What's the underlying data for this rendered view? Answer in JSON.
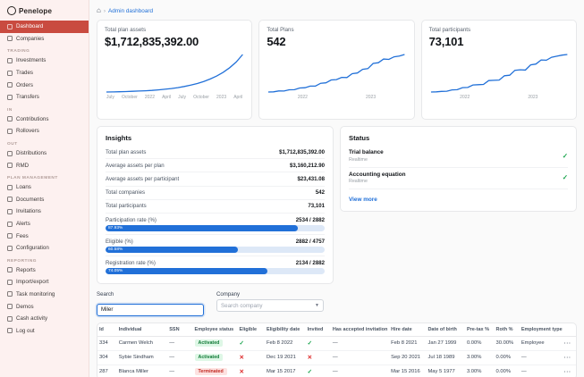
{
  "theme": {
    "accent_blue": "#2170d8",
    "sidebar_active_red": "#c94b40",
    "success_green": "#16a34a",
    "danger_red": "#dc2626",
    "chart_line": "#2170d8"
  },
  "sidebar": {
    "logo": "Penelope",
    "items": [
      {
        "label": "Dashboard",
        "icon": "dashboard-icon",
        "active": true
      },
      {
        "label": "Companies",
        "icon": "companies-icon"
      },
      {
        "section": "TRADING"
      },
      {
        "label": "Investments",
        "icon": "investments-icon"
      },
      {
        "label": "Trades",
        "icon": "trades-icon"
      },
      {
        "label": "Orders",
        "icon": "orders-icon"
      },
      {
        "label": "Transfers",
        "icon": "transfers-icon"
      },
      {
        "section": "IN"
      },
      {
        "label": "Contributions",
        "icon": "contributions-icon"
      },
      {
        "label": "Rollovers",
        "icon": "rollovers-icon"
      },
      {
        "section": "OUT"
      },
      {
        "label": "Distributions",
        "icon": "distributions-icon"
      },
      {
        "label": "RMD",
        "icon": "rmd-icon"
      },
      {
        "section": "PLAN MANAGEMENT"
      },
      {
        "label": "Loans",
        "icon": "loans-icon"
      },
      {
        "label": "Documents",
        "icon": "documents-icon"
      },
      {
        "label": "Invitations",
        "icon": "invitations-icon"
      },
      {
        "label": "Alerts",
        "icon": "alerts-icon"
      },
      {
        "label": "Fees",
        "icon": "fees-icon"
      },
      {
        "label": "Configuration",
        "icon": "configuration-icon"
      },
      {
        "section": "REPORTING"
      },
      {
        "label": "Reports",
        "icon": "reports-icon"
      },
      {
        "label": "Import/export",
        "icon": "import-export-icon"
      },
      {
        "label": "Task monitoring",
        "icon": "task-monitoring-icon"
      },
      {
        "label": "Demos",
        "icon": "demos-icon"
      },
      {
        "label": "Cash activity",
        "icon": "cash-activity-icon"
      },
      {
        "label": "Log out",
        "icon": "log-out-icon"
      }
    ]
  },
  "breadcrumb": {
    "current": "Admin dashboard"
  },
  "chart_data": [
    {
      "type": "line",
      "title": "Total plan assets",
      "value_label": "$1,712,835,392.00",
      "x_ticks": [
        "July",
        "October",
        "2022",
        "April",
        "July",
        "October",
        "2023",
        "April"
      ],
      "values": [
        1,
        1.05,
        1.1,
        1.18,
        1.27,
        1.38,
        1.5,
        1.66,
        1.85,
        2.1,
        2.4,
        2.75,
        3.2,
        3.75,
        4.4,
        5.2,
        6.2,
        7.4,
        8.9,
        10.7,
        13,
        16
      ]
    },
    {
      "type": "line",
      "title": "Total Plans",
      "value_label": "542",
      "x_ticks": [
        "2022",
        "2023"
      ],
      "values": [
        30,
        32,
        45,
        44,
        60,
        62,
        85,
        88,
        110,
        112,
        150,
        155,
        195,
        200,
        230,
        228,
        280,
        290,
        340,
        350,
        420,
        430,
        480,
        475,
        510,
        520,
        542
      ]
    },
    {
      "type": "line",
      "title": "Total participants",
      "value_label": "73,101",
      "x_ticks": [
        "2022",
        "2023"
      ],
      "values": [
        4000,
        4300,
        5200,
        5400,
        8000,
        8300,
        12000,
        12400,
        17000,
        17500,
        18000,
        25000,
        25600,
        26000,
        34000,
        35000,
        44000,
        45000,
        44500,
        54000,
        55500,
        63000,
        62500,
        68000,
        70000,
        72000,
        73101
      ]
    }
  ],
  "insights": {
    "title": "Insights",
    "rows": [
      {
        "label": "Total plan assets",
        "value": "$1,712,835,392.00"
      },
      {
        "label": "Average assets per plan",
        "value": "$3,160,212.90"
      },
      {
        "label": "Average assets per participant",
        "value": "$23,431.08"
      },
      {
        "label": "Total companies",
        "value": "542"
      },
      {
        "label": "Total participants",
        "value": "73,101"
      },
      {
        "label": "Participation rate (%)",
        "value": "2534 / 2882",
        "percent": 87.93,
        "percent_label": "87.93%"
      },
      {
        "label": "Eligible (%)",
        "value": "2882 / 4757",
        "percent": 60.58,
        "percent_label": "60.58%"
      },
      {
        "label": "Registration rate (%)",
        "value": "2134 / 2882",
        "percent": 74.05,
        "percent_label": "74.05%"
      }
    ]
  },
  "status": {
    "title": "Status",
    "items": [
      {
        "title": "Trial balance",
        "subtitle": "Realtime",
        "state": "check"
      },
      {
        "title": "Accounting equation",
        "subtitle": "Realtime",
        "state": "check"
      }
    ],
    "view_more": "View more"
  },
  "search": {
    "label": "Search",
    "value": "Miler",
    "company_label": "Company",
    "company_placeholder": "Search company"
  },
  "table": {
    "columns": [
      "Id",
      "Individual",
      "SSN",
      "Employee status",
      "Eligible",
      "Eligibility date",
      "Invited",
      "Has accepted invitation",
      "Hire date",
      "Date of birth",
      "Pre-tax %",
      "Roth %",
      "Employment type",
      ""
    ],
    "rows": [
      {
        "id": "334",
        "individual": "Carmen Welch",
        "ssn": "—",
        "employee_status": "Activated",
        "status_variant": "success",
        "eligible": "check",
        "eligibility_date": "Feb 8 2022",
        "invited": "check",
        "has_accepted_invitation": "—",
        "hire_date": "Feb 8 2021",
        "date_of_birth": "Jan 27 1999",
        "pre_tax": "0.00%",
        "roth": "30.00%",
        "employment_type": "Employee"
      },
      {
        "id": "304",
        "individual": "Sybie Sindham",
        "ssn": "—",
        "employee_status": "Activated",
        "status_variant": "success",
        "eligible": "cross",
        "eligibility_date": "Dec 19 2021",
        "invited": "cross",
        "has_accepted_invitation": "—",
        "hire_date": "Sep 20 2021",
        "date_of_birth": "Jul 18 1989",
        "pre_tax": "3.00%",
        "roth": "0.00%",
        "employment_type": "—"
      },
      {
        "id": "287",
        "individual": "Blanca Miller",
        "ssn": "—",
        "employee_status": "Terminated",
        "status_variant": "danger",
        "eligible": "cross",
        "eligibility_date": "Mar 15 2017",
        "invited": "check",
        "has_accepted_invitation": "—",
        "hire_date": "Mar 15 2016",
        "date_of_birth": "May 5 1977",
        "pre_tax": "3.00%",
        "roth": "0.00%",
        "employment_type": "—"
      }
    ]
  }
}
